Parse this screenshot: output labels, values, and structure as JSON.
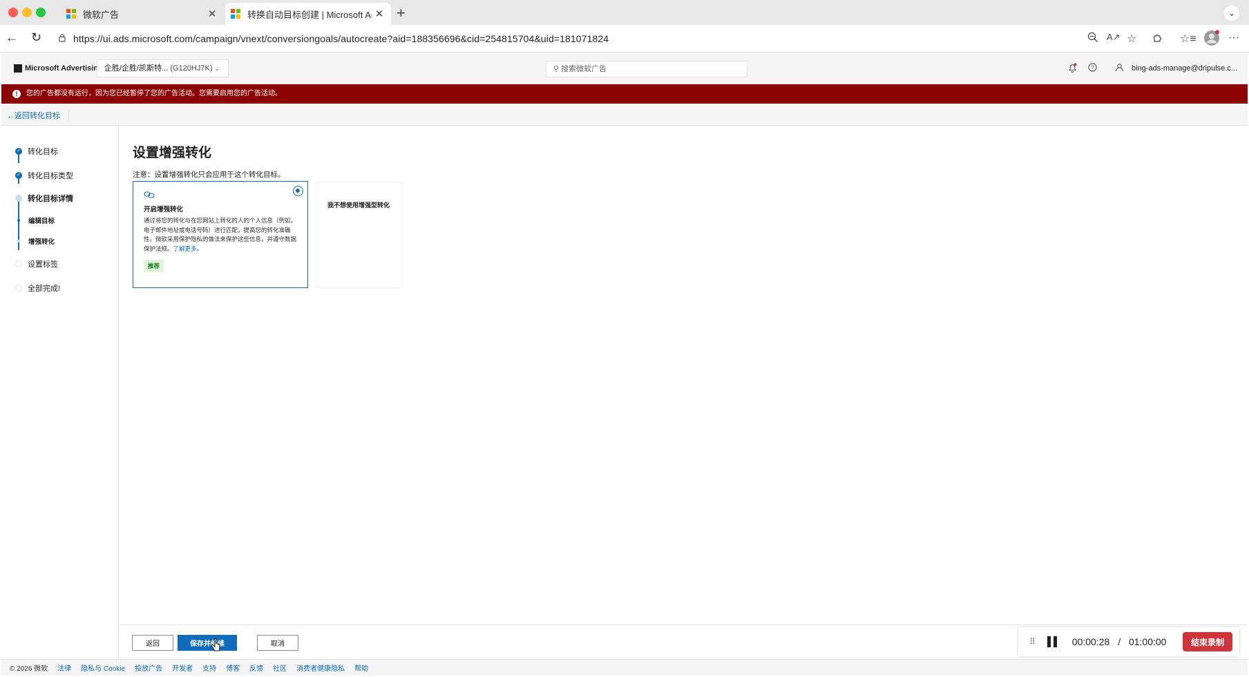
{
  "browser": {
    "tabs": [
      {
        "title": "微软广告",
        "active": false
      },
      {
        "title": "转换自动目标创建 | Microsoft Advertising",
        "active": true
      }
    ],
    "new_tab_symbol": "+",
    "url": "https://ui.ads.microsoft.com/campaign/vnext/conversiongoals/autocreate?aid=188356696&cid=254815704&uid=181071824"
  },
  "app_header": {
    "brand": "Microsoft Advertising",
    "account_name": "企胜/企胜/凯斯特...",
    "account_id": "(G120HJ7K)",
    "search_placeholder": "搜索微软广告",
    "user_email": "bing-ads-manage@dripulse.c..."
  },
  "alert": {
    "icon": "!",
    "text": "您的广告都没有运行，因为您已经暂停了您的广告活动。您需要启用您的广告活动。"
  },
  "back_link": "返回转化目标",
  "stepper": {
    "steps": [
      {
        "label": "转化目标",
        "state": "done"
      },
      {
        "label": "转化目标类型",
        "state": "done"
      },
      {
        "label": "转化目标详情",
        "state": "current"
      },
      {
        "label": "编辑目标",
        "state": "substep-done"
      },
      {
        "label": "增强转化",
        "state": "substep-current"
      },
      {
        "label": "设置标签",
        "state": "pending"
      },
      {
        "label": "全部完成!",
        "state": "pending"
      }
    ]
  },
  "main": {
    "title": "设置增强转化",
    "note": "注意：设置增强转化只会应用于这个转化目标。",
    "option_on": {
      "title": "开启增强转化",
      "description": "通过将您的转化与在您网站上转化的人的个人信息（例如，电子邮件地址或电话号码）进行匹配，提高您的转化准确性。微软采用保护隐私的做法来保护这些信息，并遵守数据保护法规。",
      "learn_more": "了解更多",
      "badge": "推荐",
      "selected": true
    },
    "option_off": {
      "title": "我不想使用增强型转化",
      "selected": false
    }
  },
  "actions": {
    "back": "返回",
    "save_continue": "保存并继续",
    "cancel": "取消"
  },
  "recorder": {
    "elapsed": "00:00:28",
    "separator": "/",
    "limit": "01:00:00",
    "stop": "结束录制"
  },
  "footer": {
    "copyright": "© 2026 微软",
    "links": [
      "法律",
      "隐私与 Cookie",
      "投放广告",
      "开发者",
      "支持",
      "博客",
      "反馈",
      "社区",
      "消费者健康隐私",
      "帮助"
    ]
  },
  "colors": {
    "accent": "#0f6cbd",
    "alert_bg": "#8b0000",
    "badge_bg": "#dff6dd",
    "stop_button": "#d13438"
  }
}
